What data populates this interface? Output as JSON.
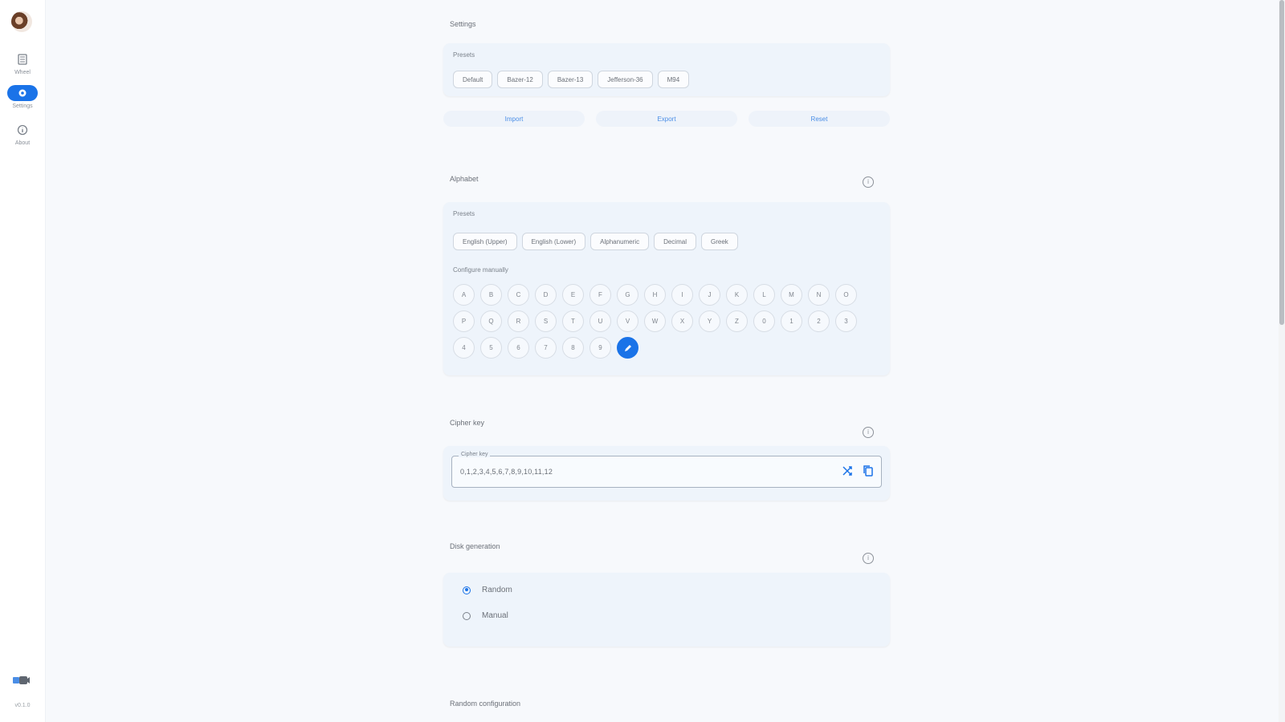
{
  "sidebar": {
    "items": [
      {
        "label": "Wheel",
        "icon": "wheel-icon"
      },
      {
        "label": "Settings",
        "icon": "settings-icon",
        "active": true
      },
      {
        "label": "About",
        "icon": "about-icon"
      }
    ],
    "bottom_icon": "theme-toggle-icon",
    "version": "v0.1.0"
  },
  "settings": {
    "title": "Settings",
    "presets_label": "Presets",
    "presets": [
      "Default",
      "Bazer-12",
      "Bazer-13",
      "Jefferson-36",
      "M94"
    ],
    "actions": [
      "Import",
      "Export",
      "Reset"
    ]
  },
  "alphabet": {
    "title": "Alphabet",
    "presets_label": "Presets",
    "presets": [
      "English (Upper)",
      "English (Lower)",
      "Alphanumeric",
      "Decimal",
      "Greek"
    ],
    "manual_label": "Configure manually",
    "letters": [
      "A",
      "B",
      "C",
      "D",
      "E",
      "F",
      "G",
      "H",
      "I",
      "J",
      "K",
      "L",
      "M",
      "N",
      "O",
      "P",
      "Q",
      "R",
      "S",
      "T",
      "U",
      "V",
      "W",
      "X",
      "Y",
      "Z",
      "0",
      "1",
      "2",
      "3",
      "4",
      "5",
      "6",
      "7",
      "8",
      "9"
    ]
  },
  "cipher_key": {
    "title": "Cipher key",
    "field_label": "Cipher key",
    "value": "0,1,2,3,4,5,6,7,8,9,10,11,12"
  },
  "disk_generation": {
    "title": "Disk generation",
    "options": [
      {
        "label": "Random",
        "checked": true
      },
      {
        "label": "Manual",
        "checked": false
      }
    ]
  },
  "random_configuration": {
    "title": "Random configuration"
  },
  "colors": {
    "accent": "#1a73e8",
    "card_bg": "#eef4fb",
    "page_bg": "#f7f9fc"
  }
}
